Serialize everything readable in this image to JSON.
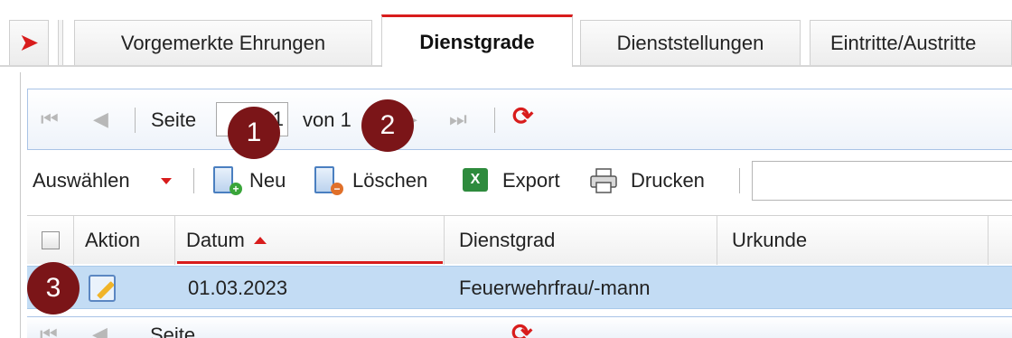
{
  "tabs": {
    "back_icon": "arrow-left-icon",
    "items": [
      {
        "label": "Vorgemerkte Ehrungen",
        "active": false
      },
      {
        "label": "Dienstgrade",
        "active": true
      },
      {
        "label": "Dienststellungen",
        "active": false
      },
      {
        "label": "Eintritte/Austritte",
        "active": false
      }
    ]
  },
  "paging": {
    "page_label": "Seite",
    "page_value": "1",
    "of_label": "von 1",
    "icons": [
      "first-page-icon",
      "prev-page-icon",
      "next-page-icon",
      "last-page-icon",
      "refresh-icon"
    ]
  },
  "toolbar": {
    "select_label": "Auswählen",
    "new_label": "Neu",
    "delete_label": "Löschen",
    "export_label": "Export",
    "print_label": "Drucken",
    "search_value": ""
  },
  "grid": {
    "columns": [
      "Aktion",
      "Datum",
      "Dienstgrad",
      "Urkunde"
    ],
    "sort_column": "Datum",
    "sort_direction": "ascending",
    "rows": [
      {
        "selected": true,
        "datum": "01.03.2023",
        "dienstgrad": "Feuerwehrfrau/-mann",
        "urkunde": ""
      }
    ]
  },
  "markers": [
    "1",
    "2",
    "3"
  ],
  "colors": {
    "accent": "#d81c1c",
    "marker": "#7b1518",
    "row_selected": "#c3dcf4",
    "paging_border": "#a9c3e6"
  }
}
